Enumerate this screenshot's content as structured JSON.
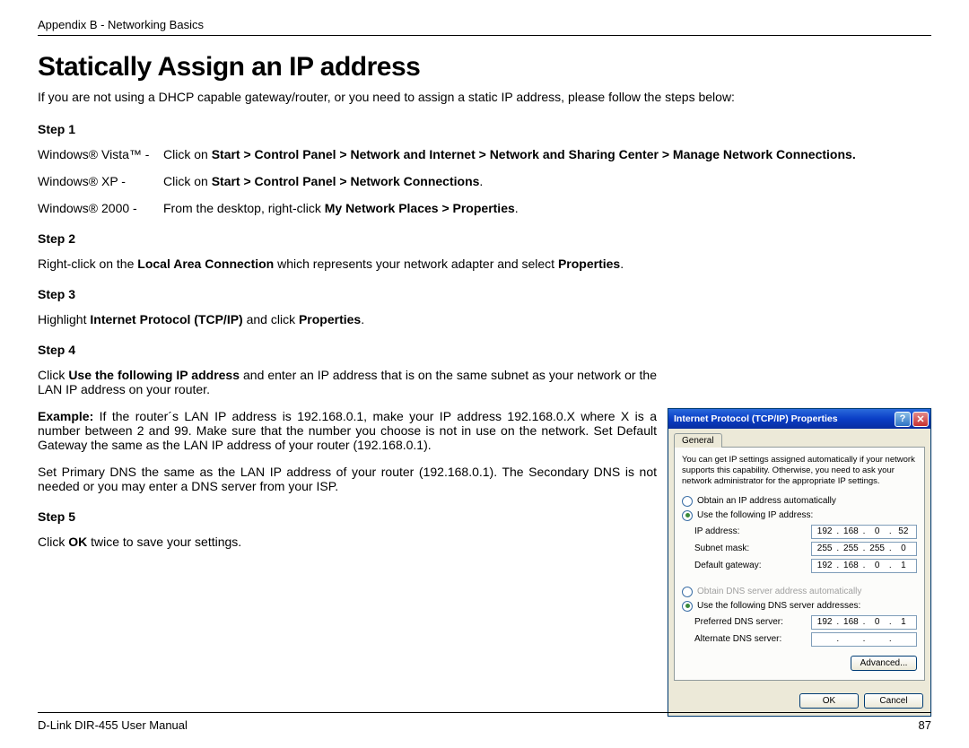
{
  "header": {
    "breadcrumb": "Appendix B - Networking Basics"
  },
  "title": "Statically Assign an IP address",
  "intro": "If you are not using a DHCP capable gateway/router, or you need to assign a static IP address, please follow the steps below:",
  "steps": {
    "s1": {
      "label": "Step 1",
      "vista_os": "Windows® Vista™ -",
      "vista_pre": "Click on ",
      "vista_bold": "Start > Control Panel > Network and Internet > Network and Sharing Center > Manage Network Connections.",
      "xp_os": "Windows® XP -",
      "xp_pre": "Click on ",
      "xp_bold": "Start > Control Panel > Network Connections",
      "xp_post": ".",
      "w2k_os": "Windows® 2000 -",
      "w2k_pre": "From the desktop, right-click ",
      "w2k_bold": "My Network Places > Properties",
      "w2k_post": "."
    },
    "s2": {
      "label": "Step 2",
      "pre": "Right-click on the ",
      "b1": "Local Area Connection",
      "mid": " which represents your network adapter and select ",
      "b2": "Properties",
      "post": "."
    },
    "s3": {
      "label": "Step 3",
      "pre": "Highlight ",
      "b1": "Internet Protocol TCP/IP)",
      "b1full": "Internet Protocol (TCP/IP)",
      "mid": " and click ",
      "b2": "Properties",
      "post": "."
    },
    "s4": {
      "label": "Step 4",
      "p1_pre": "Click ",
      "p1_b": "Use the following IP address",
      "p1_post": " and enter an IP address that is on the same subnet as your network or the LAN IP address on your router.",
      "p2_b": "Example:",
      "p2_text": " If the router´s LAN IP address is 192.168.0.1, make your IP address 192.168.0.X where X is a number between 2 and 99. Make sure that the number you choose is not in use on the network. Set Default Gateway the same as the LAN IP address of your router (192.168.0.1).",
      "p3": "Set Primary DNS the same as the LAN IP address of your router (192.168.0.1). The Secondary DNS is not needed or you may enter a DNS server from your ISP."
    },
    "s5": {
      "label": "Step 5",
      "pre": "Click ",
      "b1": "OK",
      "post": " twice to save your settings."
    }
  },
  "dialog": {
    "title": "Internet Protocol (TCP/IP) Properties",
    "tab": "General",
    "desc": "You can get IP settings assigned automatically if your network supports this capability. Otherwise, you need to ask your network administrator for the appropriate IP settings.",
    "radio_auto_ip": "Obtain an IP address automatically",
    "radio_use_ip": "Use the following IP address:",
    "lbl_ip": "IP address:",
    "lbl_mask": "Subnet mask:",
    "lbl_gw": "Default gateway:",
    "ip": [
      "192",
      "168",
      "0",
      "52"
    ],
    "mask": [
      "255",
      "255",
      "255",
      "0"
    ],
    "gw": [
      "192",
      "168",
      "0",
      "1"
    ],
    "radio_auto_dns": "Obtain DNS server address automatically",
    "radio_use_dns": "Use the following DNS server addresses:",
    "lbl_pdns": "Preferred DNS server:",
    "lbl_adns": "Alternate DNS server:",
    "pdns": [
      "192",
      "168",
      "0",
      "1"
    ],
    "btn_adv": "Advanced...",
    "btn_ok": "OK",
    "btn_cancel": "Cancel"
  },
  "footer": {
    "left": "D-Link DIR-455 User Manual",
    "right": "87"
  }
}
